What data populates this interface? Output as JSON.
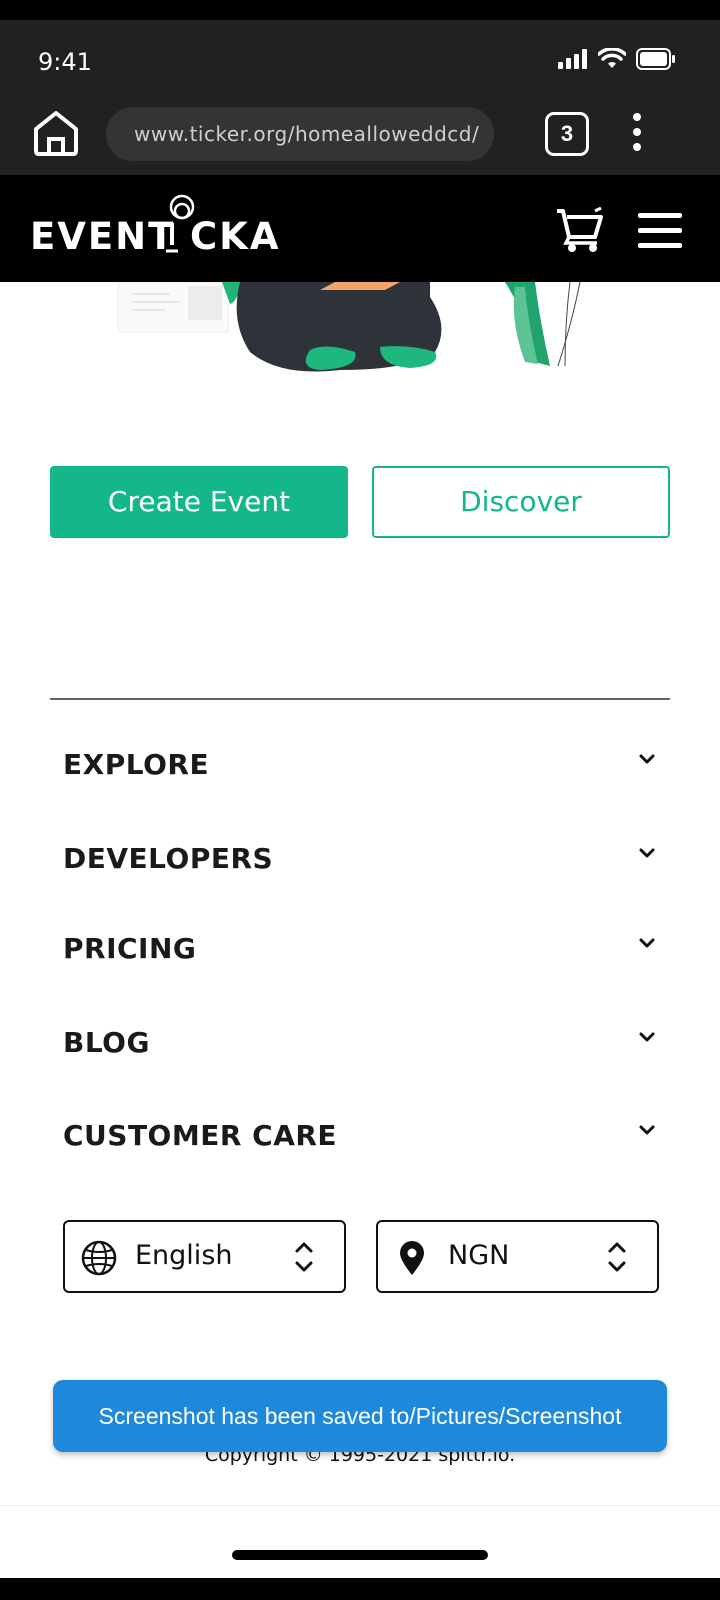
{
  "status_bar": {
    "time": "9:41"
  },
  "browser": {
    "url": "www.ticker.org/homealloweddcd/",
    "tab_count": "3"
  },
  "header": {
    "logo_text": "EVENTICKA"
  },
  "actions": {
    "create_event": "Create Event",
    "discover": "Discover"
  },
  "footer_menu": [
    {
      "label": "EXPLORE"
    },
    {
      "label": "DEVELOPERS"
    },
    {
      "label": "PRICING"
    },
    {
      "label": "BLOG"
    },
    {
      "label": "CUSTOMER CARE"
    }
  ],
  "language_select": {
    "value": "English",
    "icon": "globe-icon"
  },
  "currency_select": {
    "value": "NGN",
    "icon": "location-pin-icon"
  },
  "copyright": "Copyright © 1995-2021 spittr.io.",
  "toast": "Screenshot has been saved to/Pictures/Screenshot",
  "colors": {
    "accent": "#14b789",
    "toast": "#1e88db",
    "header_bg": "#000000",
    "browser_bg": "#212121"
  }
}
